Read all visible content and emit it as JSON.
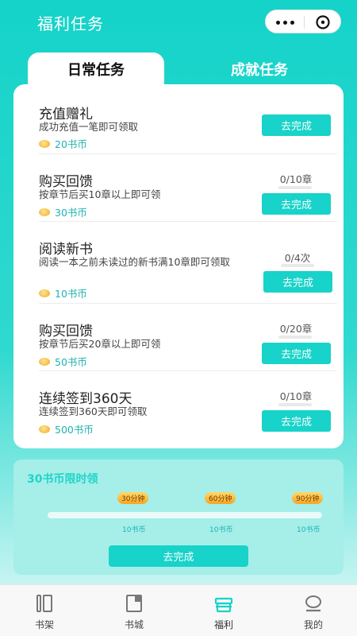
{
  "header": {
    "title": "福利任务",
    "capsule": {
      "more_icon": "more-dots-icon",
      "close_icon": "close-circle-icon"
    }
  },
  "tabs": [
    {
      "label": "日常任务",
      "active": true
    },
    {
      "label": "成就任务",
      "active": false
    }
  ],
  "tasks": [
    {
      "title": "充值赠礼",
      "desc": "成功充值一笔即可领取",
      "reward": "20书币",
      "progress_text": "",
      "progress": null,
      "button": "去完成"
    },
    {
      "title": "购买回馈",
      "desc": "按章节后买10章以上即可领",
      "reward": "30书币",
      "progress_text": "0/10章",
      "progress": 0,
      "button": "去完成"
    },
    {
      "title": "阅读新书",
      "desc": "阅读一本之前未读过的新书满10章即可领取",
      "reward": "10书币",
      "progress_text": "0/4次",
      "progress": 0,
      "button": "去完成"
    },
    {
      "title": "购买回馈",
      "desc": "按章节后买20章以上即可领",
      "reward": "50书币",
      "progress_text": "0/20章",
      "progress": 0,
      "button": "去完成"
    },
    {
      "title": "连续签到360天",
      "desc": "连续签到360天即可领取",
      "reward": "500书币",
      "progress_text": "0/10章",
      "progress": 0,
      "button": "去完成"
    }
  ],
  "promo": {
    "title": "30书币限时领",
    "milestones": [
      {
        "time": "30分钟",
        "reward": "10书币"
      },
      {
        "time": "60分钟",
        "reward": "10书币"
      },
      {
        "time": "90分钟",
        "reward": "10书币"
      }
    ],
    "progress": 0,
    "button": "去完成"
  },
  "tabbar": {
    "items": [
      {
        "label": "书架",
        "icon": "bookshelf-icon",
        "active": false
      },
      {
        "label": "书城",
        "icon": "bookstore-icon",
        "active": false
      },
      {
        "label": "福利",
        "icon": "gift-icon",
        "active": true
      },
      {
        "label": "我的",
        "icon": "profile-icon",
        "active": false
      }
    ]
  },
  "colors": {
    "accent": "#17d3c9",
    "reward_text": "#1fb3b2",
    "milestone": "#f5a623"
  }
}
